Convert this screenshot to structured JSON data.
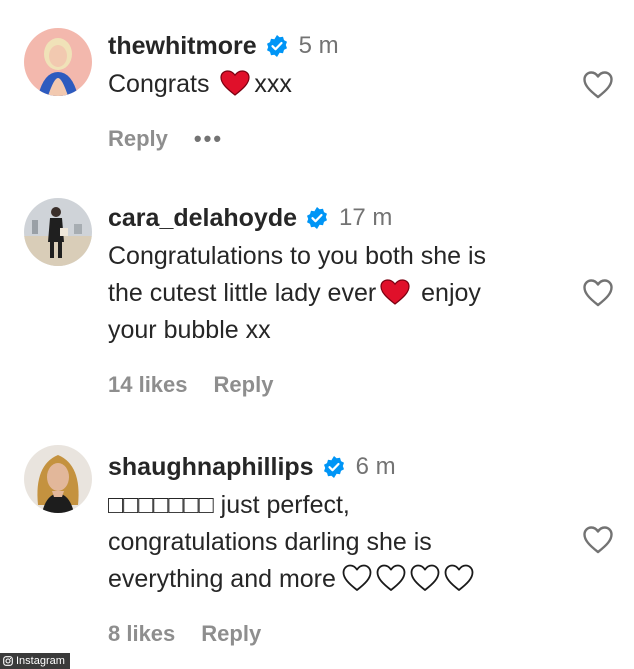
{
  "colors": {
    "text": "#262626",
    "muted": "#8e8e8e",
    "verified": "#0095f6",
    "heart_red": "#e0102a",
    "watermark_bg": "#3a3a3a"
  },
  "comments": [
    {
      "username": "thewhitmore",
      "time": "5 m",
      "text_before": "Congrats ",
      "text_after": "xxx",
      "reply_label": "Reply",
      "more_label": "•••",
      "icon": "red-heart-emoji"
    },
    {
      "username": "cara_delahoyde",
      "time": "17 m",
      "text_before": "Congratulations to you both she is\nthe cutest little lady ever",
      "text_after": " enjoy\nyour bubble xx",
      "likes_label": "14 likes",
      "reply_label": "Reply",
      "icon": "red-heart-emoji"
    },
    {
      "username": "shaughnaphillips",
      "time": "6 m",
      "text_main": "□□□□□□□ just perfect,\ncongratulations darling she is\neverything and more",
      "likes_label": "8 likes",
      "reply_label": "Reply",
      "icon": "white-heart-emoji"
    }
  ],
  "watermark": {
    "label": "Instagram",
    "icon": "instagram-camera-icon"
  }
}
